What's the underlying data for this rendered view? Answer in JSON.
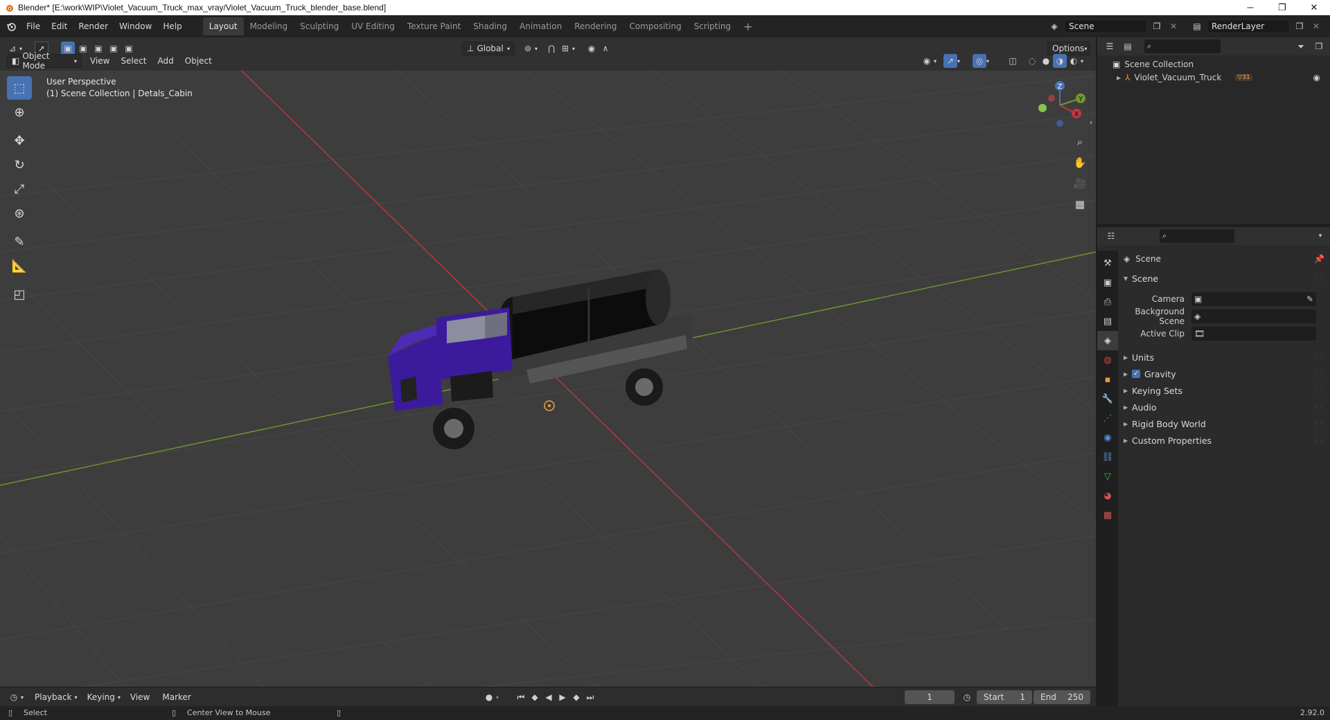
{
  "window": {
    "title": "Blender* [E:\\work\\WIP\\Violet_Vacuum_Truck_max_vray/Violet_Vacuum_Truck_blender_base.blend]",
    "minimize": "─",
    "maximize": "❐",
    "close": "✕"
  },
  "menu": [
    "File",
    "Edit",
    "Render",
    "Window",
    "Help"
  ],
  "workspaces": [
    "Layout",
    "Modeling",
    "Sculpting",
    "UV Editing",
    "Texture Paint",
    "Shading",
    "Animation",
    "Rendering",
    "Compositing",
    "Scripting"
  ],
  "workspace_add": "+",
  "scene_selector": {
    "value": "Scene"
  },
  "renderlayer_selector": {
    "value": "RenderLayer"
  },
  "viewport": {
    "transform_orientation": "Global",
    "options_label": "Options",
    "mode": "Object Mode",
    "menus": [
      "View",
      "Select",
      "Add",
      "Object"
    ],
    "overlay_line1": "User Perspective",
    "overlay_line2": "(1) Scene Collection | Detals_Cabin",
    "gizmo": {
      "z": "Z",
      "y": "Y",
      "x": "X"
    }
  },
  "outliner": {
    "root": "Scene Collection",
    "items": [
      {
        "name": "Violet_Vacuum_Truck",
        "badge": "31"
      }
    ]
  },
  "properties": {
    "context_label": "Scene",
    "panel_scene": "Scene",
    "fields": [
      {
        "label": "Camera",
        "value": ""
      },
      {
        "label": "Background Scene",
        "value": ""
      },
      {
        "label": "Active Clip",
        "value": ""
      }
    ],
    "panels": [
      "Units",
      "Gravity",
      "Keying Sets",
      "Audio",
      "Rigid Body World",
      "Custom Properties"
    ],
    "gravity_checked": true
  },
  "timeline": {
    "menus": [
      "Playback",
      "Keying",
      "View",
      "Marker"
    ],
    "current_frame": "1",
    "start_label": "Start",
    "start": "1",
    "end_label": "End",
    "end": "250"
  },
  "status": {
    "select": "Select",
    "center_view": "Center View to Mouse",
    "version": "2.92.0"
  },
  "colors": {
    "accent": "#4772b3",
    "x_axis": "#c0393f",
    "y_axis": "#6e9b2e",
    "truck": "#3b1b9c"
  }
}
